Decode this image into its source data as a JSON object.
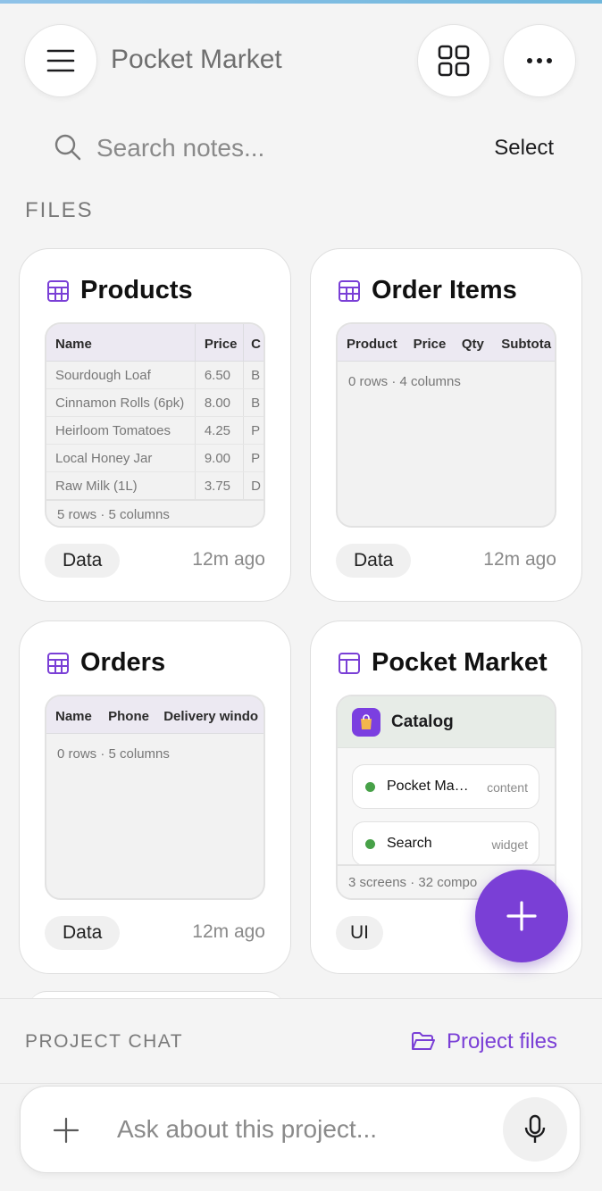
{
  "header": {
    "title": "Pocket Market",
    "menu_icon": "hamburger-icon",
    "grid_icon": "grid-icon",
    "more_icon": "more-icon"
  },
  "search": {
    "placeholder": "Search notes...",
    "select_label": "Select"
  },
  "files_section": {
    "label": "FILES"
  },
  "cards": [
    {
      "title": "Products",
      "icon": "table-icon",
      "columns": [
        "Name",
        "Price",
        "C"
      ],
      "rows": [
        [
          "Sourdough Loaf",
          "6.50",
          "B"
        ],
        [
          "Cinnamon Rolls (6pk)",
          "8.00",
          "B"
        ],
        [
          "Heirloom Tomatoes",
          "4.25",
          "P"
        ],
        [
          "Local Honey Jar",
          "9.00",
          "P"
        ],
        [
          "Raw Milk (1L)",
          "3.75",
          "D"
        ]
      ],
      "meta": "5 rows · 5 columns",
      "tag": "Data",
      "time": "12m ago"
    },
    {
      "title": "Order Items",
      "icon": "table-icon",
      "columns": [
        "Product",
        "Price",
        "Qty",
        "Subtota"
      ],
      "meta": "0 rows · 4 columns",
      "tag": "Data",
      "time": "12m ago"
    },
    {
      "title": "Orders",
      "icon": "table-icon",
      "columns": [
        "Name",
        "Phone",
        "Delivery windo"
      ],
      "meta": "0 rows · 5 columns",
      "tag": "Data",
      "time": "12m ago"
    },
    {
      "title": "Pocket Market",
      "icon": "layout-icon",
      "app_name": "Catalog",
      "items": [
        {
          "name": "Pocket Market",
          "type": "content"
        },
        {
          "name": "Search",
          "type": "widget"
        }
      ],
      "meta": "3 screens · 32 compo",
      "tag": "UI"
    }
  ],
  "fab": {
    "icon": "plus-icon"
  },
  "chat": {
    "label": "PROJECT CHAT",
    "project_files_label": "Project files",
    "input_placeholder": "Ask about this project...",
    "accent": "#7a3fd6"
  }
}
